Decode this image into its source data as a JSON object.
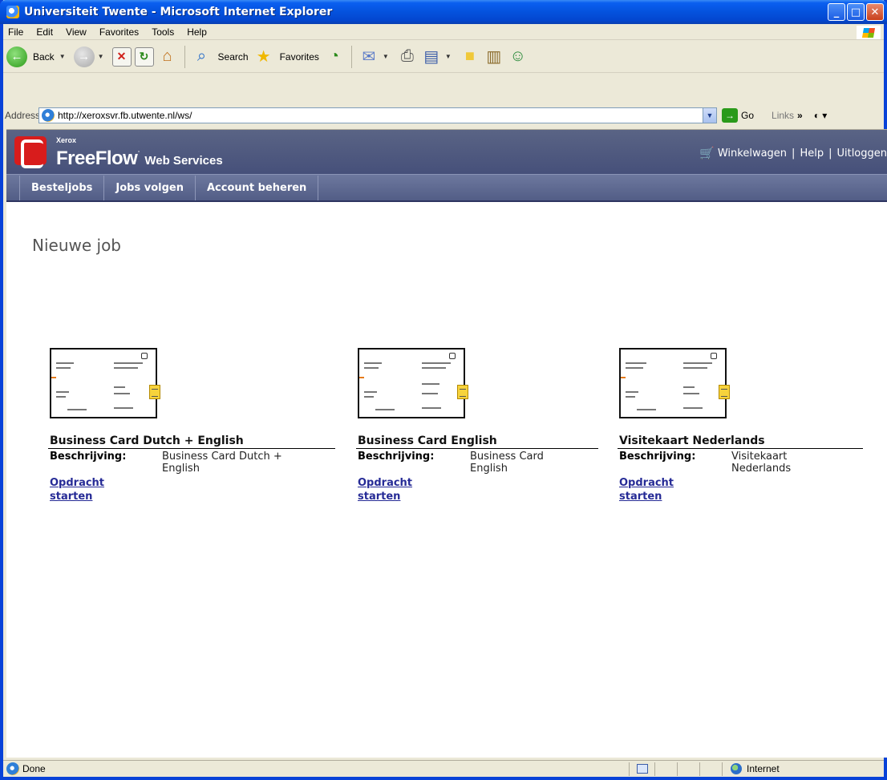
{
  "window": {
    "title": "Universiteit Twente - Microsoft Internet Explorer"
  },
  "menu": [
    "File",
    "Edit",
    "View",
    "Favorites",
    "Tools",
    "Help"
  ],
  "toolbar": {
    "back_label": "Back",
    "search_label": "Search",
    "favorites_label": "Favorites"
  },
  "address": {
    "label": "Address",
    "url": "http://xeroxsvr.fb.utwente.nl/ws/",
    "go_label": "Go",
    "links_label": "Links"
  },
  "site": {
    "brand_small": "Xerox",
    "brand_title": "FreeFlow",
    "brand_sub": "Web Services",
    "util_links": {
      "cart": "Winkelwagen",
      "help": "Help",
      "logout": "Uitloggen"
    },
    "nav": [
      "Besteljobs",
      "Jobs volgen",
      "Account beheren"
    ],
    "heading": "Nieuwe job"
  },
  "jobs": [
    {
      "title": "Business Card Dutch + English",
      "desc_label": "Beschrijving:",
      "desc_value_1": "Business Card Dutch +",
      "desc_value_2": "English",
      "link_1": "Opdracht",
      "link_2": "starten"
    },
    {
      "title": "Business Card English",
      "desc_label": "Beschrijving:",
      "desc_value_1": "Business Card",
      "desc_value_2": "English",
      "link_1": "Opdracht",
      "link_2": "starten"
    },
    {
      "title": "Visitekaart Nederlands",
      "desc_label": "Beschrijving:",
      "desc_value_1": "Visitekaart",
      "desc_value_2": "Nederlands",
      "link_1": "Opdracht",
      "link_2": "starten"
    }
  ],
  "status": {
    "text": "Done",
    "zone": "Internet"
  },
  "colors": {
    "titlebar": "#0a5ff0",
    "header": "#4e5880",
    "link": "#262b96",
    "xerox_red": "#d81c1c"
  },
  "icons": [
    "ie-icon",
    "back-icon",
    "forward-icon",
    "stop-icon",
    "refresh-icon",
    "home-icon",
    "search-icon",
    "favorites-icon",
    "history-icon",
    "mail-icon",
    "print-icon",
    "edit-icon",
    "discuss-icon",
    "research-icon",
    "messenger-icon",
    "cart-icon",
    "note-icon",
    "globe-icon"
  ]
}
